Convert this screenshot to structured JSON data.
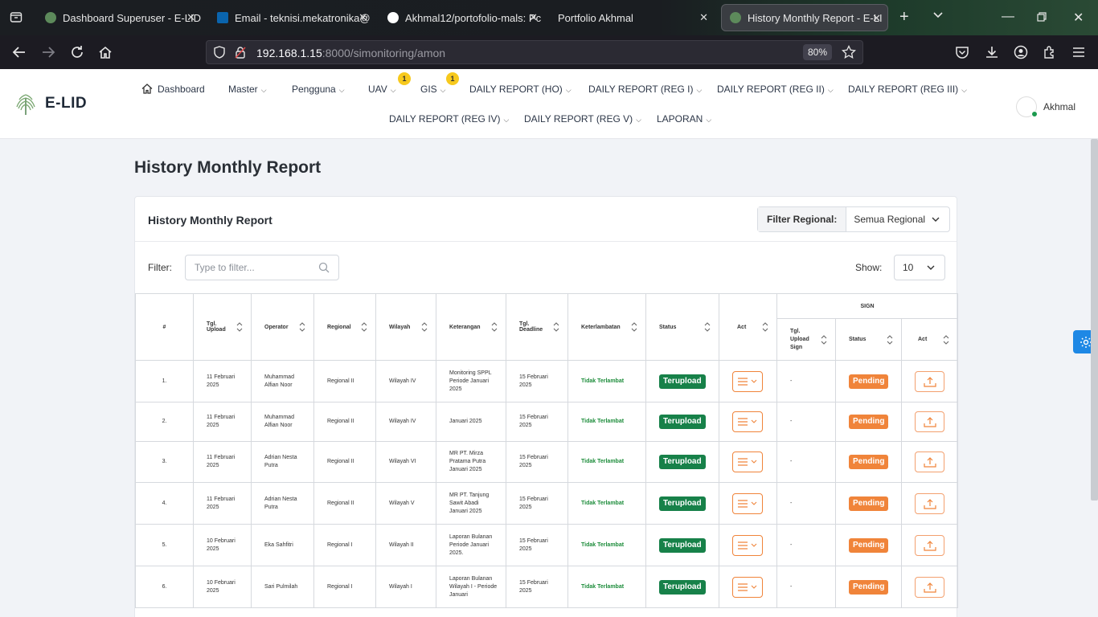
{
  "browser": {
    "tabs": [
      {
        "title": "Dashboard Superuser - E-LID",
        "favicon_color": "#6a9a6a"
      },
      {
        "title": "Email - teknisi.mekatronika@",
        "favicon_color": "#0a64ad"
      },
      {
        "title": "Akhmal12/portofolio-mals: Pc",
        "favicon_color": "#ffffff"
      },
      {
        "title": "Portfolio Akhmal",
        "favicon_color": ""
      },
      {
        "title": "History Monthly Report - E-LI",
        "favicon_color": "#6a9a6a"
      }
    ],
    "url_host": "192.168.1.15",
    "url_rest": ":8000/simonitoring/amon",
    "zoom": "80%"
  },
  "app": {
    "brand": "E-LID",
    "menu": {
      "dashboard": "Dashboard",
      "master": "Master",
      "pengguna": "Pengguna",
      "uav": "UAV",
      "uav_badge": "1",
      "gis": "GIS",
      "gis_badge": "1",
      "daily_ho": "DAILY REPORT (HO)",
      "daily_reg1": "DAILY REPORT (REG I)",
      "daily_reg2": "DAILY REPORT (REG II)",
      "daily_reg3": "DAILY REPORT (REG III)",
      "daily_reg4": "DAILY REPORT (REG IV)",
      "daily_reg5": "DAILY REPORT (REG V)",
      "laporan": "LAPORAN"
    },
    "user_name": "Akhmal"
  },
  "page": {
    "title": "History Monthly Report",
    "card_title": "History Monthly Report",
    "filter_regional_label": "Filter Regional:",
    "filter_regional_value": "Semua Regional",
    "filter_label": "Filter:",
    "filter_placeholder": "Type to filter...",
    "show_label": "Show:",
    "show_value": "10"
  },
  "table": {
    "headers": {
      "no": "#",
      "tgl_upload": "Tgl. Upload",
      "operator": "Operator",
      "regional": "Regional",
      "wilayah": "Wilayah",
      "keterangan": "Keterangan",
      "tgl_deadline": "Tgl. Deadline",
      "keterlambatan": "Keterlambatan",
      "status": "Status",
      "act": "Act",
      "sign": "SIGN",
      "sign_tgl": "Tgl. Upload Sign",
      "sign_status": "Status",
      "sign_act": "Act"
    },
    "rows": [
      {
        "no": "1.",
        "tgl_upload": "11 Februari 2025",
        "operator": "Muhammad Alfian Noor",
        "regional": "Regional II",
        "wilayah": "Wilayah IV",
        "keterangan": "Monitoring SPPL Periode Januari 2025",
        "deadline": "15 Februari 2025",
        "keterlambatan": "Tidak Terlambat",
        "status": "Terupload",
        "sign_tgl": "-",
        "sign_status": "Pending"
      },
      {
        "no": "2.",
        "tgl_upload": "11 Februari 2025",
        "operator": "Muhammad Alfian Noor",
        "regional": "Regional II",
        "wilayah": "Wilayah IV",
        "keterangan": "Januari 2025",
        "deadline": "15 Februari 2025",
        "keterlambatan": "Tidak Terlambat",
        "status": "Terupload",
        "sign_tgl": "-",
        "sign_status": "Pending"
      },
      {
        "no": "3.",
        "tgl_upload": "11 Februari 2025",
        "operator": "Adrian Nesta Putra",
        "regional": "Regional II",
        "wilayah": "Wilayah VI",
        "keterangan": "MR PT. Mirza Pratama Putra Januari 2025",
        "deadline": "15 Februari 2025",
        "keterlambatan": "Tidak Terlambat",
        "status": "Terupload",
        "sign_tgl": "-",
        "sign_status": "Pending"
      },
      {
        "no": "4.",
        "tgl_upload": "11 Februari 2025",
        "operator": "Adrian Nesta Putra",
        "regional": "Regional II",
        "wilayah": "Wilayah V",
        "keterangan": "MR PT. Tanjung Sawit Abadi Januari 2025",
        "deadline": "15 Februari 2025",
        "keterlambatan": "Tidak Terlambat",
        "status": "Terupload",
        "sign_tgl": "-",
        "sign_status": "Pending"
      },
      {
        "no": "5.",
        "tgl_upload": "10 Februari 2025",
        "operator": "Eka Sahfitri",
        "regional": "Regional I",
        "wilayah": "Wilayah II",
        "keterangan": "Laporan Bulanan Periode Januari 2025.",
        "deadline": "15 Februari 2025",
        "keterlambatan": "Tidak Terlambat",
        "status": "Terupload",
        "sign_tgl": "-",
        "sign_status": "Pending"
      },
      {
        "no": "6.",
        "tgl_upload": "10 Februari 2025",
        "operator": "Sari Pulmilah",
        "regional": "Regional I",
        "wilayah": "Wilayah I",
        "keterangan": "Laporan Bulanan Wilayah I - Periode Januari",
        "deadline": "15 Februari 2025",
        "keterlambatan": "Tidak Terlambat",
        "status": "Terupload",
        "sign_tgl": "-",
        "sign_status": "Pending"
      }
    ]
  },
  "colors": {
    "uploaded": "#178149",
    "pending": "#f0843a",
    "on_time": "#1c8c3a",
    "accent": "#1e88e5"
  }
}
